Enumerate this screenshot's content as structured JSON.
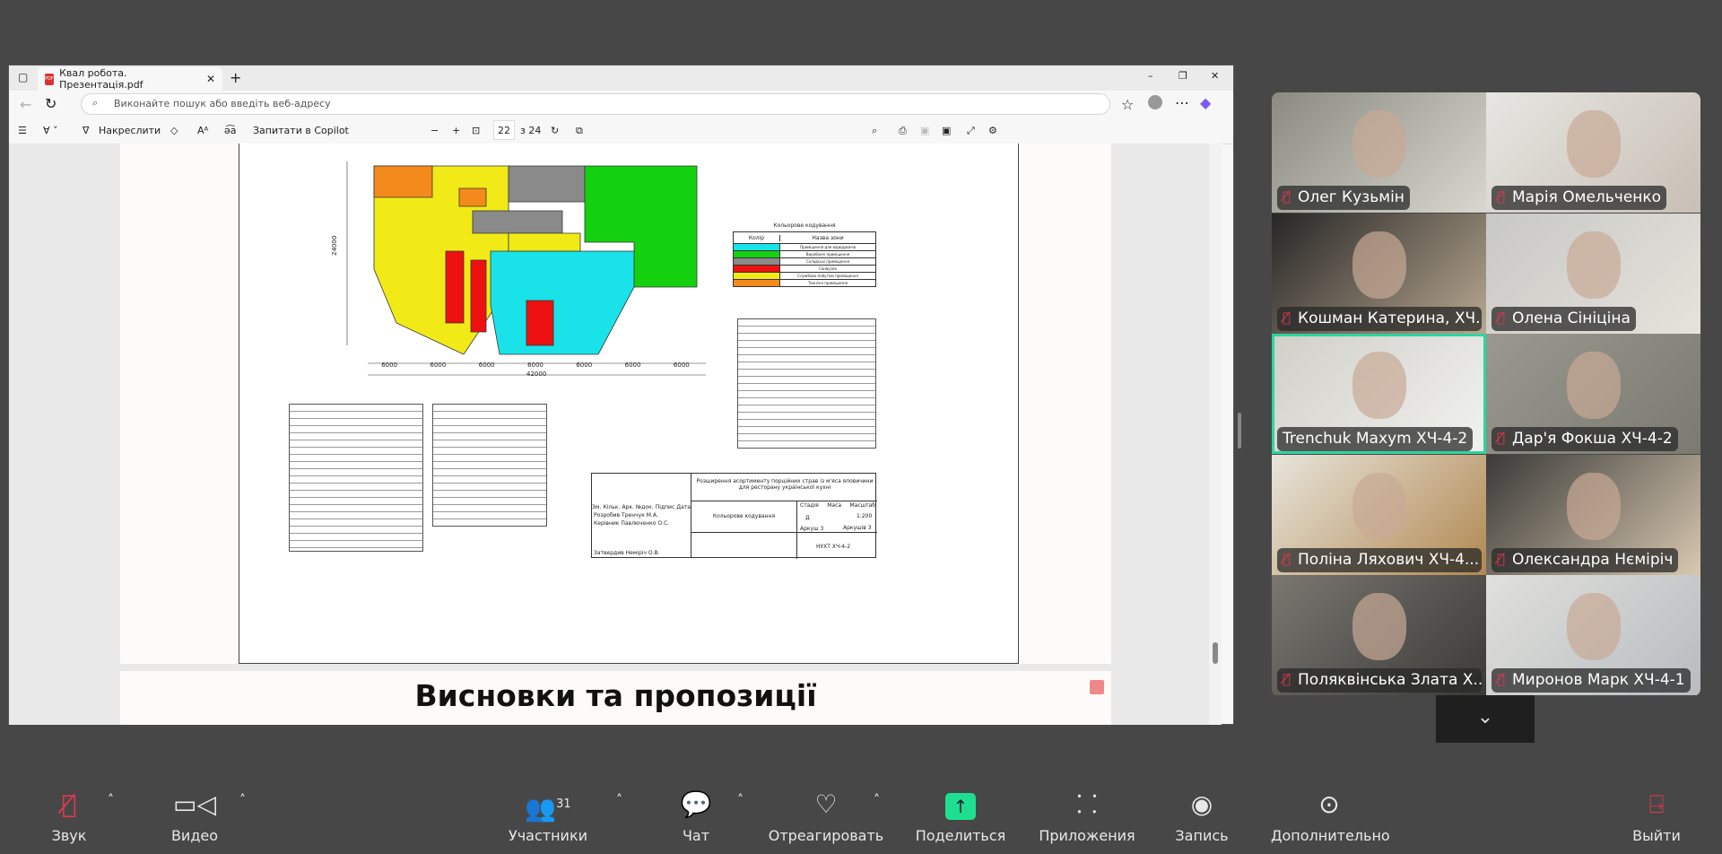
{
  "browser": {
    "tab_title": "Квал робота. Презентація.pdf",
    "address_placeholder": "Виконайте пошук або введіть веб-адресу"
  },
  "pdf_toolbar": {
    "draw_label": "Накреслити",
    "copilot_label": "Запитати в Copilot",
    "page_current": "22",
    "page_total": "з 24"
  },
  "drawing": {
    "legend_title": "Кольорове кодування",
    "legend_col_color": "Колір",
    "legend_col_name": "Назва зони",
    "legend_rows": [
      {
        "color": "#19e3e8",
        "name": "Приміщення для відвідувачів"
      },
      {
        "color": "#13d10f",
        "name": "Виробничі приміщення"
      },
      {
        "color": "#8a8a8a",
        "name": "Складські приміщення"
      },
      {
        "color": "#ee1111",
        "name": "Санвузли"
      },
      {
        "color": "#f1ea17",
        "name": "Службово-побутові приміщення"
      },
      {
        "color": "#f58a1c",
        "name": "Технічні приміщення"
      }
    ],
    "dims": [
      "6000",
      "6000",
      "6000",
      "6000",
      "6000",
      "6000",
      "6000"
    ],
    "total_dim": "42000",
    "vert_dim": "24000",
    "title_block": {
      "project": "Розширення асортименту порційних страв із м'яса яловичини для ресторану української кухні",
      "sheet_name": "Кольорове кодування",
      "h_zm": "Зм.",
      "h_kilk": "Кільк.",
      "h_ark": "Арк.",
      "h_ndok": "№док.",
      "h_pidpys": "Підпис",
      "h_data": "Дата",
      "dev_label": "Розробив",
      "dev_name": "Тренчук М.А.",
      "sup_label": "Керівник",
      "sup_name": "Павлюченко О.С.",
      "appr_label": "Затвердив",
      "appr_name": "Немірiч О.В.",
      "stage_h": "Стадія",
      "mass_h": "Маса",
      "scale_h": "Масштаб",
      "stage": "Д",
      "scale": "1:200",
      "sheet": "Аркуш 3",
      "sheets": "Аркушів 3",
      "org": "НУХТ ХЧ-4-2"
    }
  },
  "next_slide_title": "Висновки та пропозиції",
  "participants": [
    {
      "name": "Олег Кузьмін",
      "muted": true
    },
    {
      "name": "Марія Омельченко",
      "muted": true
    },
    {
      "name": "Кошман Катерина, ХЧ...",
      "muted": true
    },
    {
      "name": "Олена Сініціна",
      "muted": true
    },
    {
      "name": "Trenchuk Maxym ХЧ-4-2",
      "muted": false,
      "speaking": true
    },
    {
      "name": "Дар'я Фокша ХЧ-4-2",
      "muted": true
    },
    {
      "name": "Поліна Ляхович ХЧ-4...",
      "muted": true
    },
    {
      "name": "Олександра Нєміріч",
      "muted": true
    },
    {
      "name": "Поляквінська Злата Х...",
      "muted": true
    },
    {
      "name": "Миронов Марк ХЧ-4-1",
      "muted": true
    }
  ],
  "toolbar": {
    "audio": "Звук",
    "video": "Видео",
    "participants": "Участники",
    "participants_count": "31",
    "chat": "Чат",
    "react": "Отреагировать",
    "share": "Поделиться",
    "apps": "Приложения",
    "record": "Запись",
    "more": "Дополнительно",
    "leave": "Выйти"
  },
  "colors": {
    "accent": "#1ddf8f",
    "mute": "#e3374f",
    "leave": "#e3374f"
  }
}
